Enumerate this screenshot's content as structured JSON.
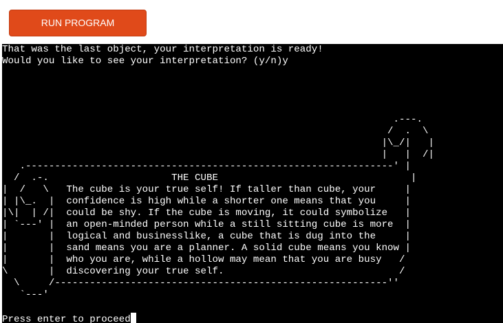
{
  "run_button": {
    "label": "RUN PROGRAM"
  },
  "terminal": {
    "lines": [
      "That was the last object, your interpretation is ready!",
      "Would you like to see your interpretation? (y/n)y",
      "",
      "",
      "",
      "",
      "                                                                   .---.",
      "                                                                  /  .  \\",
      "                                                                 |\\_/|   |",
      "                                                                 |   |  /|",
      "   .---------------------------------------------------------------' |",
      "  /  .-.                     THE CUBE                                 |",
      "|  /   \\   The cube is your true self! If taller than cube, your     |",
      "| |\\_.  |  confidence is high while a shorter one means that you     |",
      "|\\|  | /|  could be shy. If the cube is moving, it could symbolize   |",
      "| `---' |  an open-minded person while a still sitting cube is more  |",
      "|       |  logical and businesslike, a cube that is dug into the     |",
      "|       |  sand means you are a planner. A solid cube means you know |",
      "|       |  who you are, while a hollow may mean that you are busy   /",
      "\\       |  discovering your true self.                              /",
      "  \\     /---------------------------------------------------------''",
      "   `---'",
      ""
    ],
    "prompt": "Press enter to proceed"
  }
}
